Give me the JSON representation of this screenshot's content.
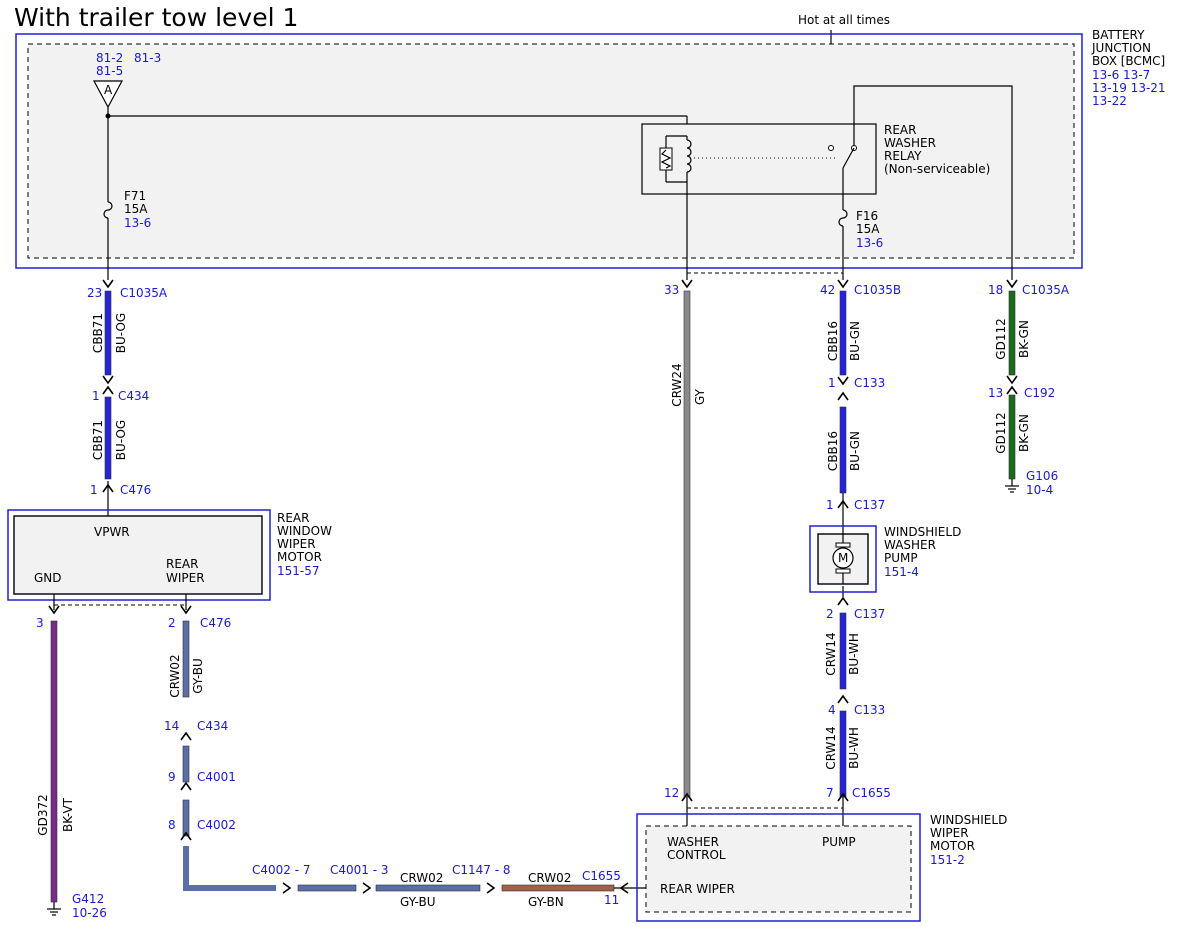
{
  "title": "With trailer tow level 1",
  "hot_label": "Hot at all times",
  "colors": {
    "BU-OG": "#2424d8",
    "BU-GN": "#2424d8",
    "BK-GN": "#1a6b1a",
    "GY": "#8a8a8a",
    "BK-VT": "#7a2a8a",
    "GY-BU": "#5a6ea8",
    "GY-BN": "#a0604a",
    "BU-WH": "#2424d8"
  },
  "bjb": {
    "name": [
      "BATTERY",
      "JUNCTION",
      "BOX [BCMC]"
    ],
    "refs": [
      "13-6  13-7",
      "13-19 13-21",
      "13-22"
    ],
    "pin_ref_a": "81-2",
    "pin_ref_b": "81-3",
    "pin_ref_c": "81-5",
    "terminal": "A",
    "fuse_f71": {
      "id": "F71",
      "amp": "15A",
      "ref": "13-6"
    },
    "fuse_f16": {
      "id": "F16",
      "amp": "15A",
      "ref": "13-6"
    },
    "relay": [
      "REAR",
      "WASHER",
      "RELAY",
      "(Non-serviceable)"
    ]
  },
  "connectors": {
    "p23": "23",
    "c1035a_1": "C1035A",
    "p1_c434": "1",
    "c434_1": "C434",
    "p1_c476": "1",
    "c476_1": "C476",
    "p33": "33",
    "p42": "42",
    "c1035b": "C1035B",
    "p1_c133": "1",
    "c133_1": "C133",
    "p1_c137": "1",
    "c137_1": "C137",
    "p18": "18",
    "c1035a_2": "C1035A",
    "p13": "13",
    "c192": "C192",
    "p3": "3",
    "p2_c476": "2",
    "c476_2": "C476",
    "p14": "14",
    "c434_2": "C434",
    "p9": "9",
    "c4001": "C4001",
    "p8": "8",
    "c4002": "C4002",
    "p2_c137": "2",
    "c137_2": "C137",
    "p4": "4",
    "c133_2": "C133",
    "p12": "12",
    "p7": "7",
    "c1655": "C1655",
    "h_c4002": "C4002 - 7",
    "h_c4001": "C4001 - 3",
    "h_c1147": "C1147 - 8",
    "h_c1655": "C1655",
    "p11": "11"
  },
  "wires": {
    "cbb71": "CBB71",
    "bu_og": "BU-OG",
    "crw24": "CRW24",
    "gy": "GY",
    "cbb16": "CBB16",
    "bu_gn": "BU-GN",
    "gd112": "GD112",
    "bk_gn": "BK-GN",
    "gd372": "GD372",
    "bk_vt": "BK-VT",
    "crw02": "CRW02",
    "gy_bu": "GY-BU",
    "gy_bn": "GY-BN",
    "crw14": "CRW14",
    "bu_wh": "BU-WH"
  },
  "grounds": {
    "g106": "G106",
    "g106_ref": "10-4",
    "g412": "G412",
    "g412_ref": "10-26"
  },
  "rwwm": {
    "name": [
      "REAR",
      "WINDOW",
      "WIPER",
      "MOTOR"
    ],
    "ref": "151-57",
    "vpwr": "VPWR",
    "gnd": "GND",
    "rear_wiper": [
      "REAR",
      "WIPER"
    ]
  },
  "wwp": {
    "name": [
      "WINDSHIELD",
      "WASHER",
      "PUMP"
    ],
    "ref": "151-4",
    "motor_symbol": "M"
  },
  "wwm": {
    "name": [
      "WINDSHIELD",
      "WIPER",
      "MOTOR"
    ],
    "ref": "151-2",
    "washer_control": [
      "WASHER",
      "CONTROL"
    ],
    "pump": "PUMP",
    "rear_wiper": "REAR WIPER"
  }
}
